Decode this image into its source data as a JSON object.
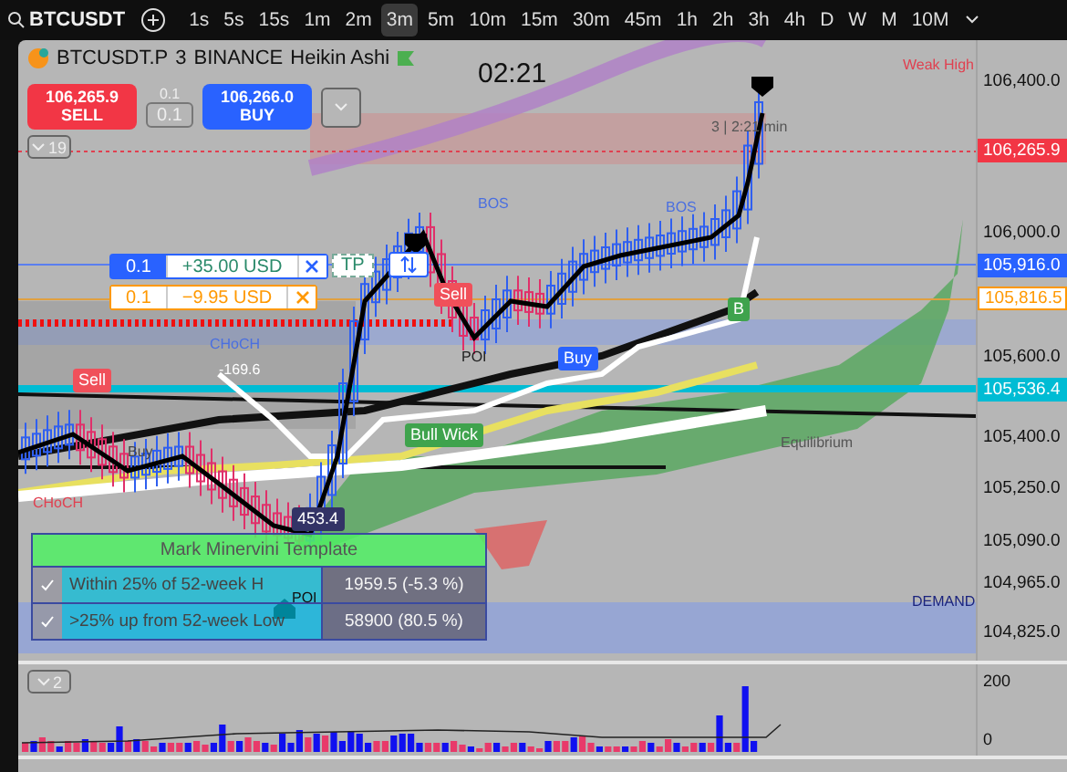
{
  "toolbar": {
    "symbol": "BTCUSDT",
    "intervals": [
      {
        "label": "1s",
        "selected": false
      },
      {
        "label": "5s",
        "selected": false
      },
      {
        "label": "15s",
        "selected": false
      },
      {
        "label": "1m",
        "selected": false
      },
      {
        "label": "2m",
        "selected": false
      },
      {
        "label": "3m",
        "selected": true
      },
      {
        "label": "5m",
        "selected": false
      },
      {
        "label": "10m",
        "selected": false
      },
      {
        "label": "15m",
        "selected": false
      },
      {
        "label": "30m",
        "selected": false
      },
      {
        "label": "45m",
        "selected": false
      },
      {
        "label": "1h",
        "selected": false
      },
      {
        "label": "2h",
        "selected": false
      },
      {
        "label": "3h",
        "selected": false
      },
      {
        "label": "4h",
        "selected": false
      },
      {
        "label": "D",
        "selected": false
      },
      {
        "label": "W",
        "selected": false
      },
      {
        "label": "M",
        "selected": false
      },
      {
        "label": "10M",
        "selected": false
      }
    ]
  },
  "legend": {
    "symbol": "BTCUSDT.P",
    "interval": "3",
    "exchange": "BINANCE",
    "chart_type": "Heikin Ashi"
  },
  "countdown": "02:21",
  "trade": {
    "sell_price": "106,265.9",
    "sell_label": "SELL",
    "qty_label": "0.1",
    "qty": "0.1",
    "buy_price": "106,266.0",
    "buy_label": "BUY"
  },
  "indicator_badge": "19",
  "orders": [
    {
      "qty": "0.1",
      "pnl": "+35.00 USD",
      "color": "#2962ff"
    },
    {
      "qty": "0.1",
      "pnl": "−9.95 USD",
      "color": "#ff9800"
    }
  ],
  "tp_label": "TP",
  "chart_labels": [
    {
      "text": "Weak High",
      "kind": "text",
      "color": "#e04050"
    },
    {
      "text": "3 | 2:21 min",
      "kind": "text",
      "color": "#555555"
    },
    {
      "text": "BOS",
      "kind": "text",
      "color": "#4a6fe0"
    },
    {
      "text": "BOS",
      "kind": "text",
      "color": "#4a6fe0"
    },
    {
      "text": "CHoCH",
      "kind": "text",
      "color": "#4a6fe0"
    },
    {
      "text": "Sell",
      "kind": "tag",
      "color": "#f0505a"
    },
    {
      "text": "Sell",
      "kind": "tag",
      "color": "#f0505a"
    },
    {
      "text": "-169.6",
      "kind": "text",
      "color": "#ffffff"
    },
    {
      "text": "Bull Wick",
      "kind": "tag",
      "color": "#3fa34d"
    },
    {
      "text": "POI",
      "kind": "text",
      "color": "#222222"
    },
    {
      "text": "Buy",
      "kind": "tag",
      "color": "#2962ff"
    },
    {
      "text": "B",
      "kind": "tag",
      "color": "#3fa34d"
    },
    {
      "text": "Equilibrium",
      "kind": "text",
      "color": "#555555"
    },
    {
      "text": "DEMAND",
      "kind": "text",
      "color": "#1a237e"
    },
    {
      "text": "Buy",
      "kind": "text",
      "color": "#444444"
    },
    {
      "text": "CHoCH",
      "kind": "text",
      "color": "#e04050"
    },
    {
      "text": "453.4",
      "kind": "tag",
      "color": "#333366"
    },
    {
      "text": "POI",
      "kind": "text",
      "color": "#111111"
    }
  ],
  "price_axis": [
    {
      "text": "106,400.0",
      "kind": "tick"
    },
    {
      "text": "106,265.9",
      "kind": "tag",
      "color": "#f23645"
    },
    {
      "text": "106,000.0",
      "kind": "tick"
    },
    {
      "text": "105,916.0",
      "kind": "tag",
      "color": "#2962ff"
    },
    {
      "text": "105,816.5",
      "kind": "outline",
      "color": "#ff9800"
    },
    {
      "text": "105,600.0",
      "kind": "tick"
    },
    {
      "text": "105,536.4",
      "kind": "tag",
      "color": "#00bcd4"
    },
    {
      "text": "105,400.0",
      "kind": "tick"
    },
    {
      "text": "105,250.0",
      "kind": "tick"
    },
    {
      "text": "105,090.0",
      "kind": "tick"
    },
    {
      "text": "104,965.0",
      "kind": "tick"
    },
    {
      "text": "104,825.0",
      "kind": "tick"
    }
  ],
  "template_table": {
    "title": "Mark Minervini Template",
    "rows": [
      {
        "checked": true,
        "label": "Within 25% of 52-week H",
        "value": "1959.5 (-5.3 %)"
      },
      {
        "checked": true,
        "label": ">25% up from 52-week Low",
        "value": "58900 (80.5 %)"
      }
    ]
  },
  "volume_pane": {
    "badge": "2",
    "axis": [
      "200",
      "0"
    ]
  }
}
